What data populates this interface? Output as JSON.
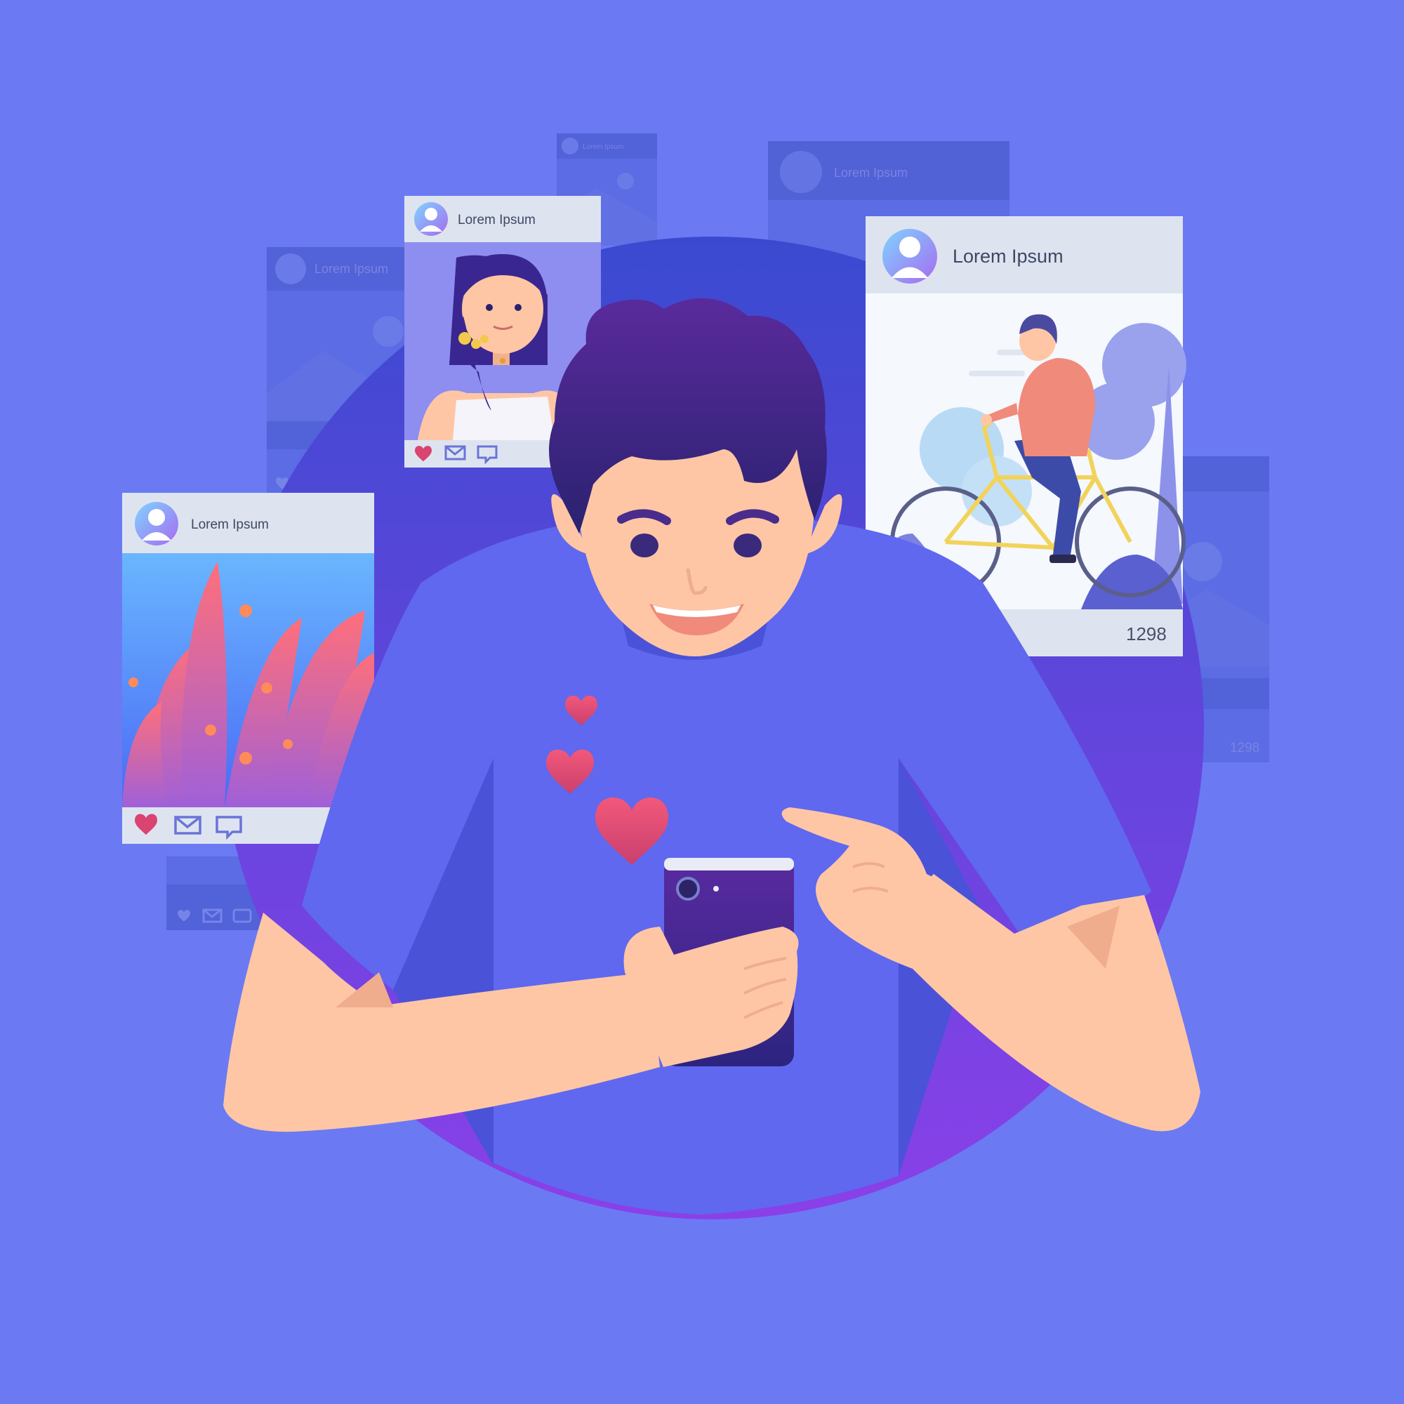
{
  "posts": {
    "back_left": {
      "username": "Lorem Ipsum"
    },
    "back_top": {
      "username": "Lorem Ipsum"
    },
    "back_right": {
      "username": "Lorem Ipsum"
    },
    "back_far_right": {
      "like_count": "1298"
    },
    "woman": {
      "username": "Lorem Ipsum"
    },
    "plants": {
      "username": "Lorem Ipsum"
    },
    "cyclist": {
      "username": "Lorem Ipsum",
      "like_count": "1298"
    }
  },
  "icons": [
    "heart-icon",
    "envelope-icon",
    "comment-icon",
    "avatar-icon"
  ],
  "colors": {
    "background": "#6b7af2",
    "circle": "#4b48d6",
    "shirt": "#5f68ee",
    "skin": "#ffc6a5",
    "hair": "#3a2690",
    "heart": "#e84a78",
    "card_header": "#dde4ef"
  }
}
